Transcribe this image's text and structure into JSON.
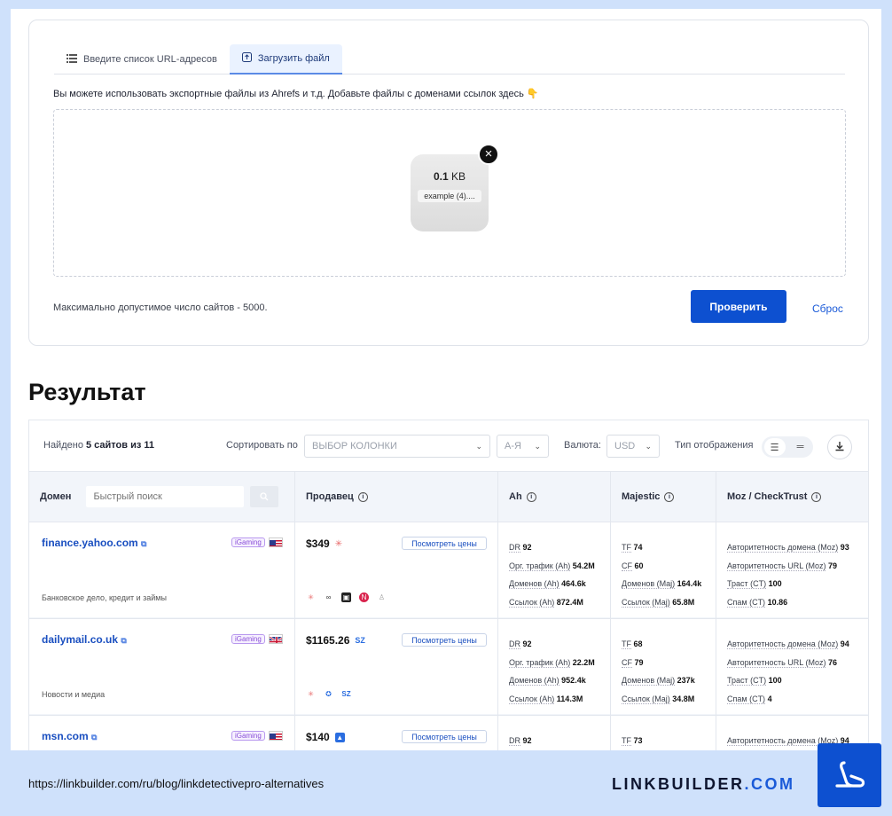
{
  "upload": {
    "tabs": [
      {
        "label": "Введите список URL-адресов",
        "icon": "list-icon"
      },
      {
        "label": "Загрузить файл",
        "icon": "upload-icon"
      }
    ],
    "hint": "Вы можете использовать экспортные файлы из Ahrefs и т.д. Добавьте файлы с доменами ссылок здесь 👇",
    "file": {
      "size_value": "0.1",
      "size_unit": "KB",
      "name": "example (4)...."
    },
    "max_note": "Максимально допустимое число сайтов - 5000.",
    "check_label": "Проверить",
    "reset_label": "Сброс"
  },
  "result_title": "Результат",
  "toolbar": {
    "found_prefix": "Найдено",
    "found_count": "5 сайтов из 11",
    "sort_label": "Сортировать по",
    "sort_value": "ВЫБОР КОЛОНКИ",
    "order_value": "А-Я",
    "currency_label": "Валюта:",
    "currency_value": "USD",
    "view_label": "Тип отображения"
  },
  "columns": {
    "domain": "Домен",
    "search_placeholder": "Быстрый поиск",
    "seller": "Продавец",
    "ah": "Ah",
    "majestic": "Majestic",
    "moz": "Moz / CheckTrust"
  },
  "prices_button": "Посмотреть цены",
  "rows": [
    {
      "domain": "finance.yahoo.com",
      "badge": "iGaming",
      "flag": "us",
      "category": "Банковское дело, кредит и займы",
      "price": "$349",
      "ah": {
        "dr_label": "DR",
        "dr": "92",
        "traffic_label": "Орг. трафик (Ah)",
        "traffic": "54.2M",
        "domains_label": "Доменов (Ah)",
        "domains": "464.6k",
        "links_label": "Ссылок (Ah)",
        "links": "872.4M"
      },
      "majestic": {
        "tf_label": "TF",
        "tf": "74",
        "cf_label": "CF",
        "cf": "60",
        "domains_label": "Доменов (Maj)",
        "domains": "164.4k",
        "links_label": "Ссылок (Maj)",
        "links": "65.8M"
      },
      "moz": {
        "da_label": "Авторитетность домена (Moz)",
        "da": "93",
        "pa_label": "Авторитетность URL (Moz)",
        "pa": "79",
        "trust_label": "Траст (CT)",
        "trust": "100",
        "spam_label": "Спам (CT)",
        "spam": "10.86"
      }
    },
    {
      "domain": "dailymail.co.uk",
      "badge": "iGaming",
      "flag": "gb",
      "category": "Новости и медиа",
      "price": "$1165.26",
      "ah": {
        "dr_label": "DR",
        "dr": "92",
        "traffic_label": "Орг. трафик (Ah)",
        "traffic": "22.2M",
        "domains_label": "Доменов (Ah)",
        "domains": "952.4k",
        "links_label": "Ссылок (Ah)",
        "links": "114.3M"
      },
      "majestic": {
        "tf_label": "TF",
        "tf": "68",
        "cf_label": "CF",
        "cf": "79",
        "domains_label": "Доменов (Maj)",
        "domains": "237k",
        "links_label": "Ссылок (Maj)",
        "links": "34.8M"
      },
      "moz": {
        "da_label": "Авторитетность домена (Moz)",
        "da": "94",
        "pa_label": "Авторитетность URL (Moz)",
        "pa": "76",
        "trust_label": "Траст (CT)",
        "trust": "100",
        "spam_label": "Спам (CT)",
        "spam": "4"
      }
    },
    {
      "domain": "msn.com",
      "badge": "iGaming",
      "flag": "us",
      "category": "",
      "price": "$140",
      "ah": {
        "dr_label": "DR",
        "dr": "92"
      },
      "majestic": {
        "tf_label": "TF",
        "tf": "73"
      },
      "moz": {
        "da_label": "Авторитетность домена (Moz)",
        "da": "94"
      }
    }
  ],
  "footer": {
    "url": "https://linkbuilder.com/ru/blog/linkdetectivepro-alternatives",
    "brand_main": "LINKBUILDER",
    "brand_dot": ".",
    "brand_tld": "COM"
  }
}
